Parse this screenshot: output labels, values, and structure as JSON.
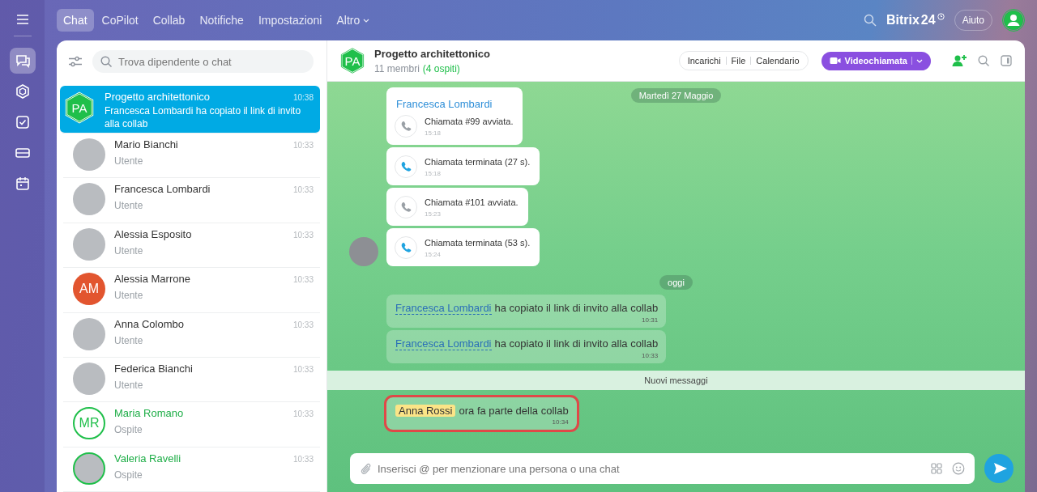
{
  "rail": [
    {
      "kind": "chat",
      "selected": true
    },
    {
      "kind": "hexagon",
      "selected": false
    },
    {
      "kind": "tasks",
      "selected": false
    },
    {
      "kind": "drive",
      "selected": false
    },
    {
      "kind": "calendar",
      "selected": false
    }
  ],
  "nav": [
    {
      "label": "Chat",
      "selected": true,
      "dropdown": false
    },
    {
      "label": "CoPilot",
      "selected": false,
      "dropdown": false
    },
    {
      "label": "Collab",
      "selected": false,
      "dropdown": false
    },
    {
      "label": "Notifiche",
      "selected": false,
      "dropdown": false
    },
    {
      "label": "Impostazioni",
      "selected": false,
      "dropdown": false
    },
    {
      "label": "Altro",
      "selected": false,
      "dropdown": true
    }
  ],
  "brand": {
    "name": "Bitrix",
    "number": "24"
  },
  "help": "Aiuto",
  "search": {
    "placeholder": "Trova dipendente o chat"
  },
  "chats": [
    {
      "name": "Progetto architettonico",
      "time": "10:38",
      "preview": "Francesca Lombardi ha copiato il link di invito alla collab",
      "kind": "group",
      "initials": "PA",
      "guest": false,
      "selected": true
    },
    {
      "name": "Mario Bianchi",
      "time": "10:33",
      "preview": "Utente",
      "kind": "photo",
      "guest": false,
      "selected": false
    },
    {
      "name": "Francesca Lombardi",
      "time": "10:33",
      "preview": "Utente",
      "kind": "photo",
      "guest": false,
      "selected": false
    },
    {
      "name": "Alessia Esposito",
      "time": "10:33",
      "preview": "Utente",
      "kind": "photo",
      "guest": false,
      "selected": false
    },
    {
      "name": "Alessia Marrone",
      "time": "10:33",
      "preview": "Utente",
      "kind": "initials",
      "initials": "AM",
      "color": "#e2552f",
      "guest": false,
      "selected": false
    },
    {
      "name": "Anna Colombo",
      "time": "10:33",
      "preview": "Utente",
      "kind": "photo",
      "guest": false,
      "selected": false
    },
    {
      "name": "Federica Bianchi",
      "time": "10:33",
      "preview": "Utente",
      "kind": "photo",
      "guest": false,
      "selected": false
    },
    {
      "name": "Maria Romano",
      "time": "10:33",
      "preview": "Ospite",
      "kind": "initials",
      "initials": "MR",
      "color": "#1fbf4a",
      "guest": true,
      "selected": false
    },
    {
      "name": "Valeria Ravelli",
      "time": "10:33",
      "preview": "Ospite",
      "kind": "photo",
      "guest": true,
      "selected": false
    }
  ],
  "header": {
    "initials": "PA",
    "title": "Progetto architettonico",
    "members": "11 membri",
    "guests": "(4 ospiti)",
    "tabs": [
      "Incarichi",
      "File",
      "Calendario"
    ],
    "call_button": "Videochiamata"
  },
  "messages": [
    {
      "kind": "date",
      "text": "Martedì 27 Maggio"
    },
    {
      "kind": "call",
      "sender": "Francesca Lombardi",
      "ended": false,
      "text": "Chiamata #99 avviata.",
      "time": "15:18"
    },
    {
      "kind": "call",
      "ended": true,
      "text": "Chiamata terminata (27 s).",
      "time": "15:18"
    },
    {
      "kind": "call",
      "ended": false,
      "text": "Chiamata #101 avviata.",
      "time": "15:23"
    },
    {
      "kind": "call",
      "ended": true,
      "text": "Chiamata terminata (53 s).",
      "time": "15:24",
      "avatar": true
    },
    {
      "kind": "date",
      "text": "oggi"
    },
    {
      "kind": "system",
      "mention": "Francesca Lombardi",
      "text": "ha copiato il link di invito alla collab",
      "time": "10:31",
      "highlighted": false
    },
    {
      "kind": "system",
      "mention": "Francesca Lombardi",
      "text": "ha copiato il link di invito alla collab",
      "time": "10:33",
      "highlighted": false
    },
    {
      "kind": "divider",
      "text": "Nuovi messaggi"
    },
    {
      "kind": "system",
      "mention": "Anna Rossi",
      "text": "ora fa parte della collab",
      "time": "10:34",
      "highlighted": true
    }
  ],
  "composer": {
    "placeholder": "Inserisci @ per menzionare una persona o una chat"
  }
}
